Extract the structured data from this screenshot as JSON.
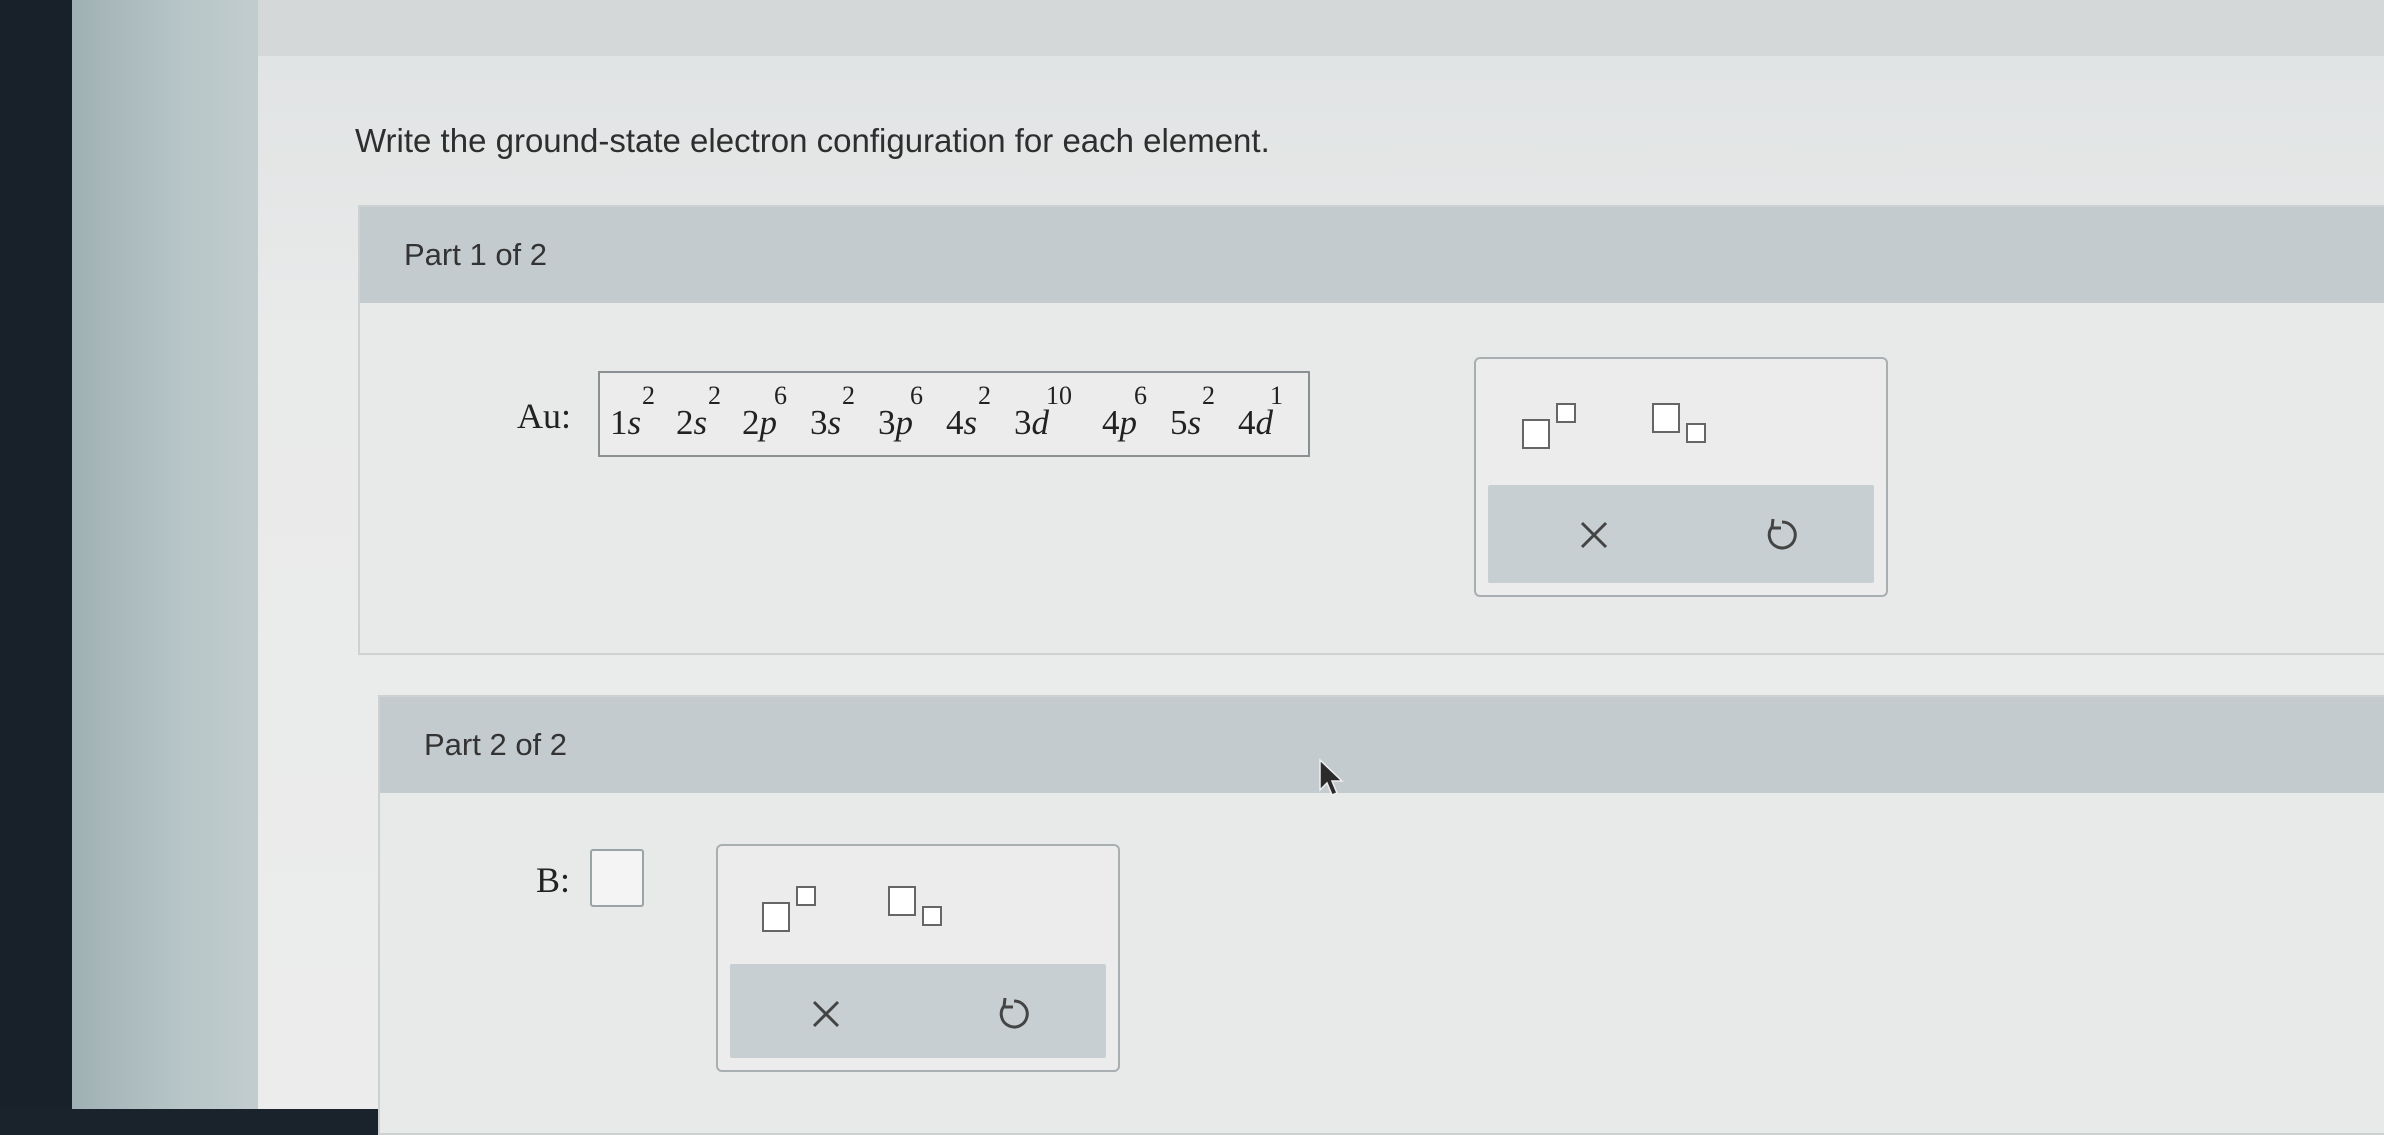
{
  "question": "Write the ground-state electron configuration for each element.",
  "part1": {
    "title": "Part 1 of 2",
    "element_label": "Au:",
    "answer_terms": [
      {
        "base": "1",
        "orbital": "s",
        "exp": "2"
      },
      {
        "base": "2",
        "orbital": "s",
        "exp": "2"
      },
      {
        "base": "2",
        "orbital": "p",
        "exp": "6"
      },
      {
        "base": "3",
        "orbital": "s",
        "exp": "2"
      },
      {
        "base": "3",
        "orbital": "p",
        "exp": "6"
      },
      {
        "base": "4",
        "orbital": "s",
        "exp": "2"
      },
      {
        "base": "3",
        "orbital": "d",
        "exp": "10"
      },
      {
        "base": "4",
        "orbital": "p",
        "exp": "6"
      },
      {
        "base": "5",
        "orbital": "s",
        "exp": "2"
      },
      {
        "base": "4",
        "orbital": "d",
        "exp": "1"
      }
    ]
  },
  "part2": {
    "title": "Part 2 of 2",
    "element_label": "B:",
    "answer_value": ""
  },
  "toolbox": {
    "superscript_icon": "superscript-template-icon",
    "subscript_icon": "subscript-template-icon",
    "clear_icon": "x-icon",
    "undo_icon": "undo-icon"
  },
  "colors": {
    "panel_header": "#c4cbce",
    "action_bar": "#c8cfd2",
    "text": "#2e2e2e"
  }
}
